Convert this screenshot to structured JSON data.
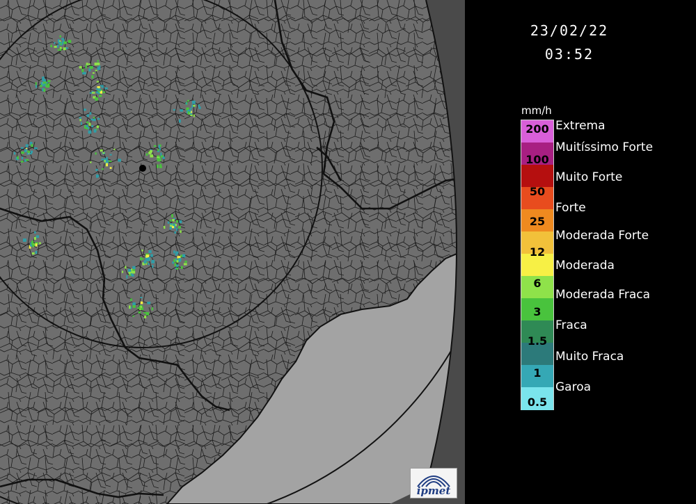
{
  "header": {
    "date": "23/02/22",
    "time": "03:52"
  },
  "legend": {
    "unit": "mm/h",
    "values": [
      "200",
      "100",
      "50",
      "25",
      "12",
      "6",
      "3",
      "1.5",
      "1",
      "0.5"
    ],
    "categories": [
      "Extrema",
      "Muitíssimo Forte",
      "Muito Forte",
      "Forte",
      "Moderada Forte",
      "Moderada",
      "Moderada Fraca",
      "Fraca",
      "Muito Fraca",
      "Garoa"
    ],
    "colors": [
      "#d95fd9",
      "#a81f82",
      "#b50f0f",
      "#e84c1e",
      "#ef8a1f",
      "#f2c13a",
      "#f7f045",
      "#8fe24a",
      "#49c33d",
      "#2f8a55",
      "#2c7a7a",
      "#35a8b5",
      "#7ae4ec"
    ]
  },
  "map": {
    "background_color": "#6e6e6e",
    "coast_sea_color": "#a3a3a3",
    "border_color": "#111111",
    "echo_colors": [
      "#2f9ea8",
      "#49c33d",
      "#8fe24a",
      "#f7f045"
    ]
  },
  "logo": {
    "text": "ipmet"
  }
}
